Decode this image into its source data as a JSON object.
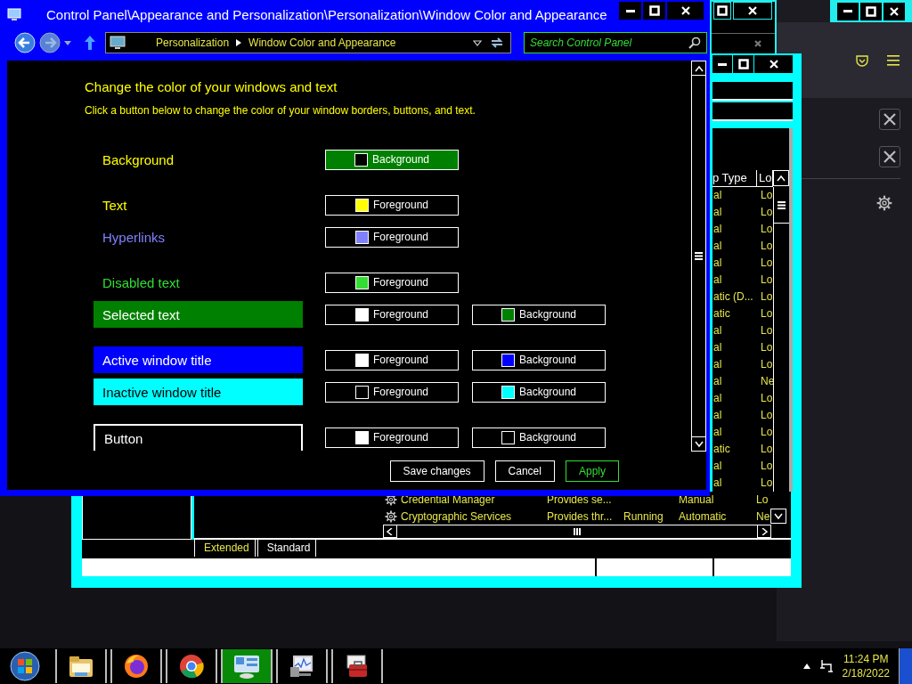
{
  "main_window": {
    "title": "Control Panel\\Appearance and Personalization\\Personalization\\Window Color and Appearance",
    "breadcrumb": [
      "Personalization",
      "Window Color and Appearance"
    ],
    "search": {
      "placeholder": "Search Control Panel"
    },
    "heading": "Change the color of your windows and text",
    "instruction": "Click a button below to change the color of your window borders, buttons, and text.",
    "groups": [
      {
        "items": [
          {
            "label": "Background",
            "kind": "plain",
            "color": "#ffff00",
            "buttons": [
              {
                "label": "Background",
                "color": "#000000",
                "selected": true
              }
            ]
          }
        ]
      },
      {
        "items": [
          {
            "label": "Text",
            "kind": "plain",
            "color": "#ffff00",
            "buttons": [
              {
                "label": "Foreground",
                "color": "#ffff00",
                "selected": false
              }
            ]
          },
          {
            "label": "Hyperlinks",
            "kind": "plain",
            "color": "#8080ff",
            "buttons": [
              {
                "label": "Foreground",
                "color": "#8080ff",
                "selected": false
              }
            ]
          }
        ]
      },
      {
        "items": [
          {
            "label": "Disabled text",
            "kind": "plain",
            "color": "#33dd33",
            "buttons": [
              {
                "label": "Foreground",
                "color": "#33dd33",
                "selected": false
              }
            ]
          },
          {
            "label": "Selected text",
            "kind": "block",
            "color": "#ffffff",
            "background": {
              "color": "#008000"
            },
            "buttons": [
              {
                "label": "Foreground",
                "color": "#ffffff",
                "selected": false
              },
              {
                "label": "Background",
                "color": "#008000",
                "selected": false
              }
            ]
          }
        ]
      },
      {
        "items": [
          {
            "label": "Active window title",
            "kind": "block",
            "color": "#ffffff",
            "background": {
              "color": "#0000ff"
            },
            "buttons": [
              {
                "label": "Foreground",
                "color": "#ffffff",
                "selected": false
              },
              {
                "label": "Background",
                "color": "#0000ff",
                "selected": false
              }
            ]
          },
          {
            "label": "Inactive window title",
            "kind": "block",
            "color": "#000000",
            "background": {
              "color": "#00ffff"
            },
            "buttons": [
              {
                "label": "Foreground",
                "color": "#000000",
                "selected": false
              },
              {
                "label": "Background",
                "color": "#00ffff",
                "selected": false
              }
            ]
          }
        ]
      },
      {
        "items": [
          {
            "label": "Button",
            "kind": "outlined",
            "color": "#ffffff",
            "buttons": [
              {
                "label": "Foreground",
                "color": "#ffffff",
                "selected": false
              },
              {
                "label": "Background",
                "color": "#000000",
                "selected": false
              }
            ]
          }
        ]
      }
    ],
    "actions": [
      {
        "label": "Save changes",
        "disabled": false
      },
      {
        "label": "Cancel",
        "disabled": false
      },
      {
        "label": "Apply",
        "disabled": true
      }
    ]
  },
  "services_window": {
    "columns": [
      "p Type",
      "Lo"
    ],
    "strip_rows": [
      {
        "type": "al",
        "logon": "Lo"
      },
      {
        "type": "al",
        "logon": "Lo"
      },
      {
        "type": "al",
        "logon": "Lo"
      },
      {
        "type": "al",
        "logon": "Lo"
      },
      {
        "type": "al",
        "logon": "Lo"
      },
      {
        "type": "al",
        "logon": "Lo"
      },
      {
        "type": "atic (D...",
        "logon": "Lo"
      },
      {
        "type": "atic",
        "logon": "Lo"
      },
      {
        "type": "al",
        "logon": "Lo"
      },
      {
        "type": "al",
        "logon": "Lo"
      },
      {
        "type": "al",
        "logon": "Lo"
      },
      {
        "type": "al",
        "logon": "Ne"
      },
      {
        "type": "al",
        "logon": "Lo"
      },
      {
        "type": "al",
        "logon": "Lo"
      },
      {
        "type": "al",
        "logon": "Lo"
      },
      {
        "type": "atic",
        "logon": "Lo"
      },
      {
        "type": "al",
        "logon": "Lo"
      },
      {
        "type": "al",
        "logon": "Lo"
      }
    ],
    "rows": [
      {
        "name": "Credential Manager",
        "description": "Provides se...",
        "startup": "Manual",
        "logon": "Lo"
      },
      {
        "name": "Cryptographic Services",
        "description": "Provides thr...",
        "status": "Running",
        "startup": "Automatic",
        "logon": "Ne"
      }
    ],
    "tabs": [
      {
        "label": "Extended",
        "selected": true
      },
      {
        "label": "Standard",
        "selected": false
      }
    ]
  },
  "taskbar": {
    "apps": [
      {
        "kind": "folder",
        "active": false
      },
      {
        "kind": "firefox",
        "active": false
      },
      {
        "kind": "chrome",
        "active": false
      },
      {
        "kind": "control-panel",
        "active": true
      },
      {
        "kind": "monitor",
        "active": false
      },
      {
        "kind": "toolbox",
        "active": false
      }
    ],
    "clock": {
      "time": "11:24 PM",
      "date": "2/18/2022"
    }
  }
}
